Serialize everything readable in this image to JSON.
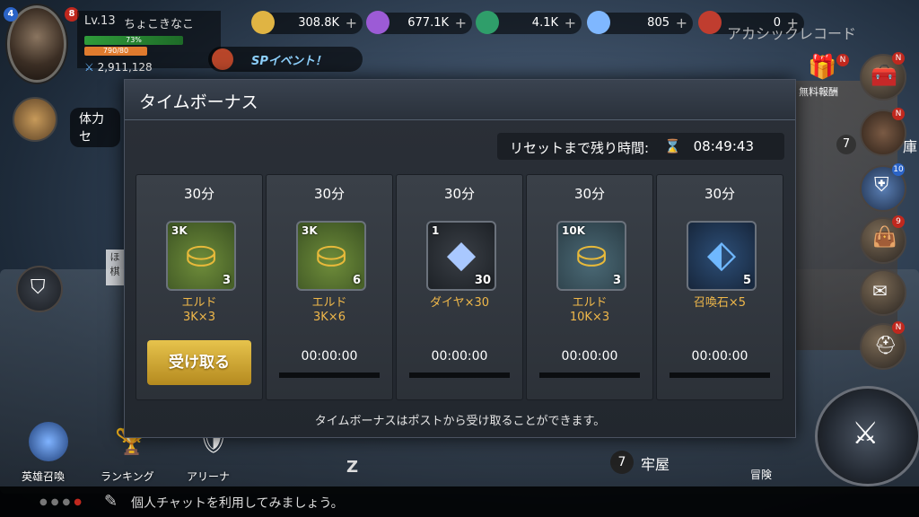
{
  "player": {
    "level": "Lv.13",
    "name": "ちょこきなこ",
    "avatar_badge": "4",
    "notif_badge": "8",
    "hp_text": "73%",
    "exp_text": "790/80",
    "power": "2,911,128"
  },
  "resources": [
    {
      "name": "gold",
      "value": "308.8K",
      "icon": "gold-coin-icon",
      "color": "#e0b443"
    },
    {
      "name": "crystal",
      "value": "677.1K",
      "icon": "purple-crystal-icon",
      "color": "#9c5bd6"
    },
    {
      "name": "orb",
      "value": "4.1K",
      "icon": "green-orb-icon",
      "color": "#2f9e6a"
    },
    {
      "name": "diamond",
      "value": "805",
      "icon": "diamond-icon",
      "color": "#7fb7ff"
    },
    {
      "name": "ruby",
      "value": "0",
      "icon": "ruby-icon",
      "color": "#c03d2f"
    }
  ],
  "sp_event_label": "SPイベント！",
  "arcana_label": "アカシックレコード",
  "stamina_label": "体力セ",
  "free_reward_label": "無料報酬",
  "warehouse_label": "庫",
  "warehouse_count": "7",
  "prison_count": "7",
  "prison_label": "牢屋",
  "adventure_label": "冒険",
  "hidden_left_label": "ほ",
  "hidden_left_label2": "棋",
  "side_badges": {
    "reward": "N",
    "chest": "N",
    "hero": "N",
    "guild": "10",
    "bag": "9",
    "helmet": "N"
  },
  "bottom_nav": [
    {
      "label": "英雄召喚"
    },
    {
      "label": "ランキング"
    },
    {
      "label": "アリーナ"
    }
  ],
  "panel": {
    "title": "タイムボーナス",
    "reset_label": "リセットまで残り時間:",
    "reset_time": "08:49:43",
    "footer": "タイムボーナスはポストから受け取ることができます。",
    "cards": [
      {
        "duration": "30分",
        "tag": "3K",
        "qty": "3",
        "name_line1": "エルド",
        "name_line2": "3K×3",
        "claim": "受け取る",
        "timer": ""
      },
      {
        "duration": "30分",
        "tag": "3K",
        "qty": "6",
        "name_line1": "エルド",
        "name_line2": "3K×6",
        "claim": "",
        "timer": "00:00:00"
      },
      {
        "duration": "30分",
        "tag": "1",
        "qty": "30",
        "name_line1": "ダイヤ×30",
        "name_line2": "",
        "claim": "",
        "timer": "00:00:00"
      },
      {
        "duration": "30分",
        "tag": "10K",
        "qty": "3",
        "name_line1": "エルド",
        "name_line2": "10K×3",
        "claim": "",
        "timer": "00:00:00"
      },
      {
        "duration": "30分",
        "tag": "",
        "qty": "5",
        "name_line1": "召喚石×5",
        "name_line2": "",
        "claim": "",
        "timer": "00:00:00"
      }
    ]
  },
  "chat": {
    "text": "個人チャットを利用してみましょう。"
  },
  "misc": {
    "z_glyph": "Z"
  }
}
